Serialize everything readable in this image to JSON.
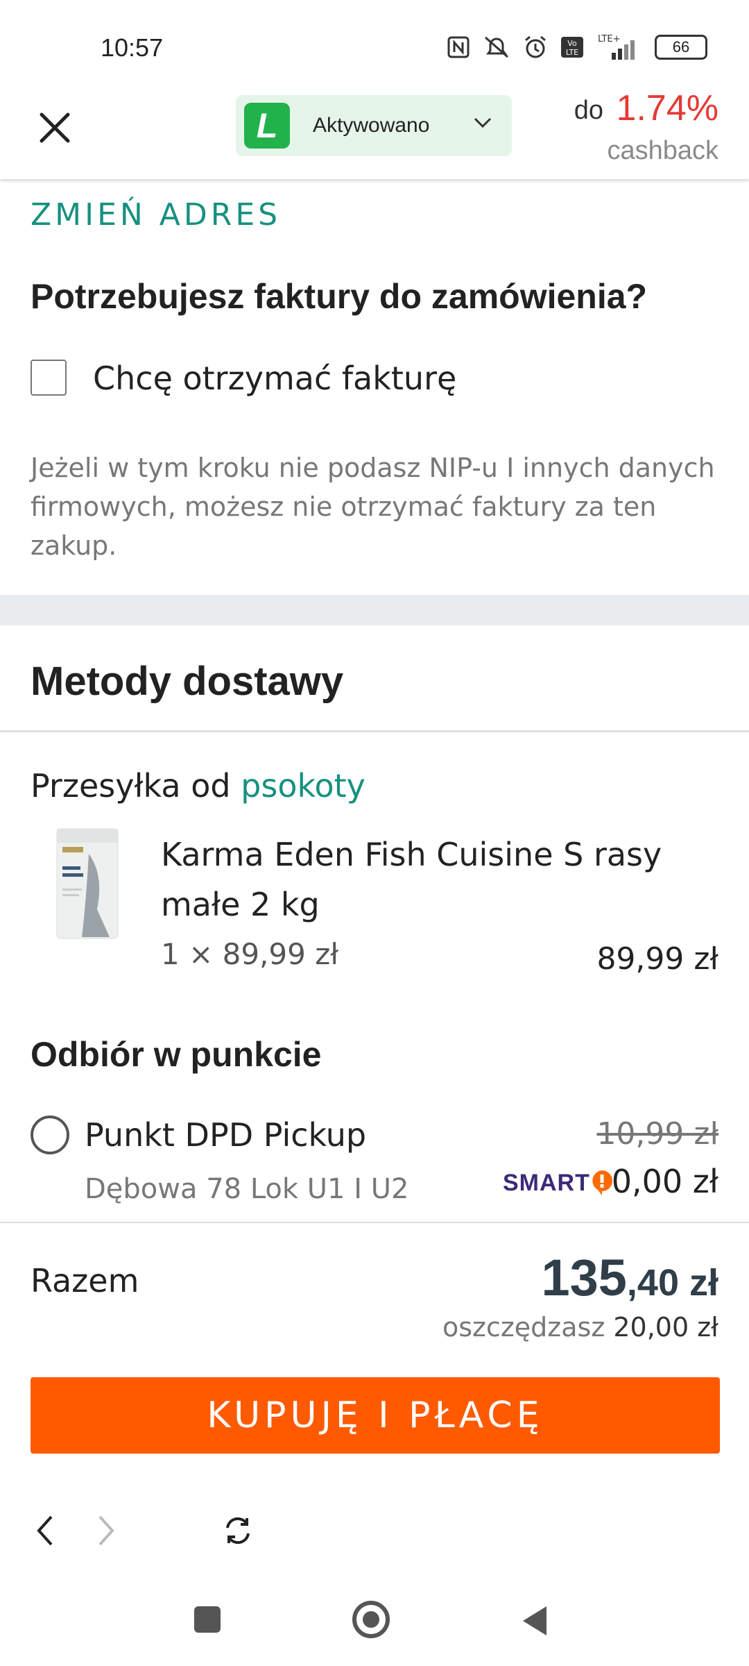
{
  "status_bar": {
    "time": "10:57",
    "battery": "66",
    "network": "LTE+"
  },
  "header": {
    "extension_logo_letter": "L",
    "extension_status": "Aktywowano",
    "cashback_prefix": "do",
    "cashback_value": "1.74%",
    "cashback_label": "cashback"
  },
  "address": {
    "change_link": "ZMIEŃ ADRES"
  },
  "invoice": {
    "heading": "Potrzebujesz faktury do zamówienia?",
    "checkbox_label": "Chcę otrzymać fakturę",
    "checkbox_checked": false,
    "hint": "Jeżeli w tym kroku nie podasz NIP-u I innych danych firmowych, możesz nie otrzymać faktury za ten zakup."
  },
  "delivery": {
    "heading": "Metody dostawy",
    "ship_from_prefix": "Przesyłka od",
    "seller": "psokoty",
    "product": {
      "name": "Karma Eden Fish Cuisine S rasy małe 2 kg",
      "quantity_price": "1 × 89,99 zł",
      "total": "89,99 zł"
    },
    "pickup_heading": "Odbiór w punkcie",
    "option": {
      "name": "Punkt DPD Pickup",
      "address": "Dębowa 78 Lok U1 I U2",
      "old_price": "10,99 zł",
      "smart_label": "SMART",
      "price": "0,00 zł",
      "selected": false
    }
  },
  "summary": {
    "label": "Razem",
    "amount_int": "135",
    "amount_rest": ",40 zł",
    "savings_label": "oszczędzasz",
    "savings_value": "20,00 zł"
  },
  "buy_button": "KUPUJĘ I PŁACĘ",
  "colors": {
    "accent": "#16917e",
    "buy": "#ff5a00",
    "cashback": "#e53935",
    "smart": "#3c2a78",
    "smart_badge": "#ff6a00"
  }
}
